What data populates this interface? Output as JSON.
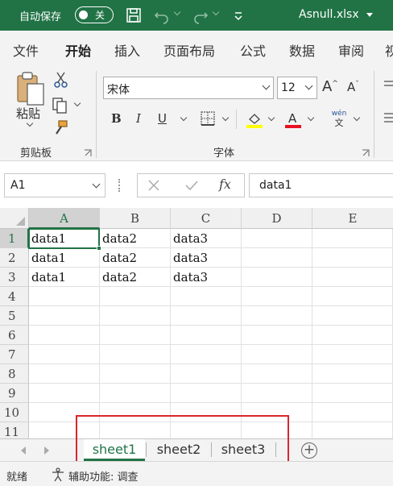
{
  "titlebar": {
    "autosave_label": "自动保存",
    "toggle_state": "关",
    "filename": "Asnull.xlsx",
    "accent_color": "#217346"
  },
  "menu": {
    "tabs": [
      "文件",
      "开始",
      "插入",
      "页面布局",
      "公式",
      "数据",
      "审阅",
      "视"
    ],
    "active": "开始"
  },
  "ribbon": {
    "clipboard": {
      "paste_label": "粘贴",
      "group_label": "剪贴板"
    },
    "font": {
      "font_name": "宋体",
      "font_size": "12",
      "bold": "B",
      "italic": "I",
      "underline": "U",
      "phonetic_top": "wén",
      "phonetic_bottom": "文",
      "group_label": "字体",
      "highlight_color": "#ffff00",
      "font_color": "#e81123"
    }
  },
  "formula_bar": {
    "name_box": "A1",
    "formula": "data1",
    "fx_label": "fx"
  },
  "grid": {
    "columns": [
      "A",
      "B",
      "C",
      "D",
      "E"
    ],
    "selected_column": "A",
    "rows": [
      "1",
      "2",
      "3",
      "4",
      "5",
      "6",
      "7",
      "8",
      "9",
      "10",
      "11"
    ],
    "selected_row": "1",
    "cells": [
      [
        "data1",
        "data2",
        "data3",
        "",
        ""
      ],
      [
        "data1",
        "data2",
        "data3",
        "",
        ""
      ],
      [
        "data1",
        "data2",
        "data3",
        "",
        ""
      ]
    ]
  },
  "sheets": {
    "tabs": [
      "sheet1",
      "sheet2",
      "sheet3"
    ],
    "active": "sheet1",
    "highlight_color": "#d9262c"
  },
  "status": {
    "ready": "就绪",
    "accessibility": "辅助功能: 调查"
  }
}
